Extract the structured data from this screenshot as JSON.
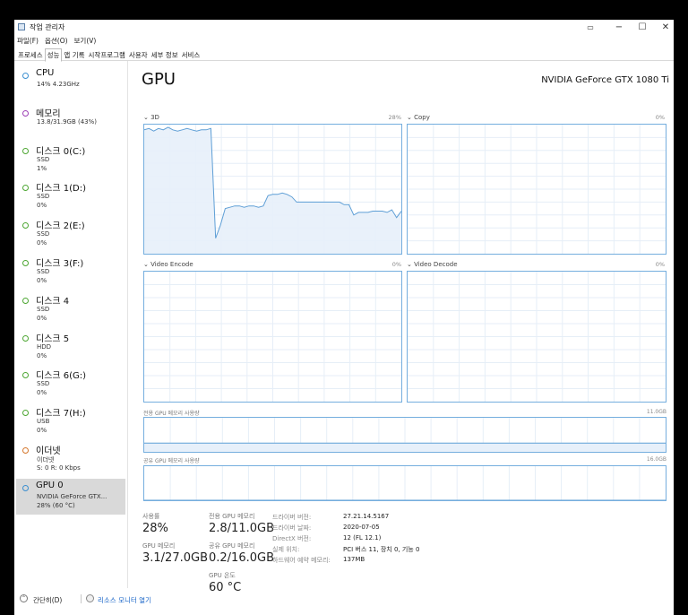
{
  "window": {
    "title": "작업 관리자",
    "minimize": "−",
    "maximize": "☐",
    "close": "✕",
    "icon": "task-manager-icon"
  },
  "menu": [
    "파일(F)",
    "옵션(O)",
    "보기(V)"
  ],
  "tabs": [
    {
      "label": "프로세스",
      "active": false
    },
    {
      "label": "성능",
      "active": true
    },
    {
      "label": "앱 기록",
      "active": false
    },
    {
      "label": "시작프로그램",
      "active": false
    },
    {
      "label": "사용자",
      "active": false
    },
    {
      "label": "세부 정보",
      "active": false
    },
    {
      "label": "서비스",
      "active": false
    }
  ],
  "sidebar": {
    "items": [
      {
        "name": "CPU",
        "line1": "14% 4.23GHz",
        "line2": "",
        "color": "#3b8fd0",
        "active": false
      },
      {
        "name": "메모리",
        "line1": "13.8/31.9GB (43%)",
        "line2": "",
        "color": "#9c3fb5",
        "active": false
      },
      {
        "name": "디스크 0(C:)",
        "line1": "SSD",
        "line2": "1%",
        "color": "#4da632",
        "active": false
      },
      {
        "name": "디스크 1(D:)",
        "line1": "SSD",
        "line2": "0%",
        "color": "#4da632",
        "active": false
      },
      {
        "name": "디스크 2(E:)",
        "line1": "SSD",
        "line2": "0%",
        "color": "#4da632",
        "active": false
      },
      {
        "name": "디스크 3(F:)",
        "line1": "SSD",
        "line2": "0%",
        "color": "#4da632",
        "active": false
      },
      {
        "name": "디스크 4",
        "line1": "SSD",
        "line2": "0%",
        "color": "#4da632",
        "active": false
      },
      {
        "name": "디스크 5",
        "line1": "HDD",
        "line2": "0%",
        "color": "#4da632",
        "active": false
      },
      {
        "name": "디스크 6(G:)",
        "line1": "SSD",
        "line2": "0%",
        "color": "#4da632",
        "active": false
      },
      {
        "name": "디스크 7(H:)",
        "line1": "USB",
        "line2": "0%",
        "color": "#4da632",
        "active": false
      },
      {
        "name": "이더넷",
        "line1": "이더넷",
        "line2": "S: 0  R: 0 Kbps",
        "color": "#d4762b",
        "active": false
      },
      {
        "name": "GPU 0",
        "line1": "NVIDIA GeForce GTX...",
        "line2": "28% (60 °C)",
        "color": "#3b8fd0",
        "active": true
      }
    ]
  },
  "main": {
    "title": "GPU",
    "model": "NVIDIA GeForce GTX 1080 Ti",
    "engines": [
      {
        "label": "3D",
        "percent": "28%",
        "values": [
          96,
          97,
          95,
          97,
          96,
          98,
          96,
          95,
          96,
          97,
          96,
          95,
          96,
          96,
          97,
          12,
          22,
          35,
          36,
          37,
          37,
          36,
          37,
          37,
          36,
          37,
          45,
          46,
          46,
          47,
          46,
          44,
          40,
          40,
          40,
          40,
          40,
          40,
          40,
          40,
          40,
          40,
          38,
          38,
          30,
          32,
          32,
          32,
          33,
          33,
          33,
          32,
          34,
          28,
          33
        ]
      },
      {
        "label": "Copy",
        "percent": "0%",
        "values": []
      },
      {
        "label": "Video Encode",
        "percent": "0%",
        "values": []
      },
      {
        "label": "Video Decode",
        "percent": "0%",
        "values": []
      }
    ],
    "dedicated_memory": {
      "label": "전용 GPU 메모리 사용량",
      "max": "11.0GB",
      "fraction": 0.255
    },
    "shared_memory": {
      "label": "공유 GPU 메모리 사용량",
      "max": "16.0GB",
      "fraction": 0.0
    },
    "stats": {
      "utilization_label": "사용률",
      "utilization": "28%",
      "dedicated_label": "전용 GPU 메모리",
      "dedicated": "2.8/11.0GB",
      "gpu_memory_label": "GPU 메모리",
      "gpu_memory": "3.1/27.0GB",
      "shared_label": "공유 GPU 메모리",
      "shared": "0.2/16.0GB",
      "temp_label": "GPU 온도",
      "temp": "60 °C"
    },
    "info": [
      {
        "key": "드라이버 버전:",
        "value": "27.21.14.5167"
      },
      {
        "key": "드라이버 날짜:",
        "value": "2020-07-05"
      },
      {
        "key": "DirectX 버전:",
        "value": "12 (FL 12.1)"
      },
      {
        "key": "실제 위치:",
        "value": "PCI 버스 11, 장치 0, 기능 0"
      },
      {
        "key": "하드웨어 예약 메모리:",
        "value": "137MB"
      }
    ]
  },
  "footer": {
    "fewer_details": "간단히(D)",
    "resource_monitor": "리소스 모니터 열기"
  }
}
